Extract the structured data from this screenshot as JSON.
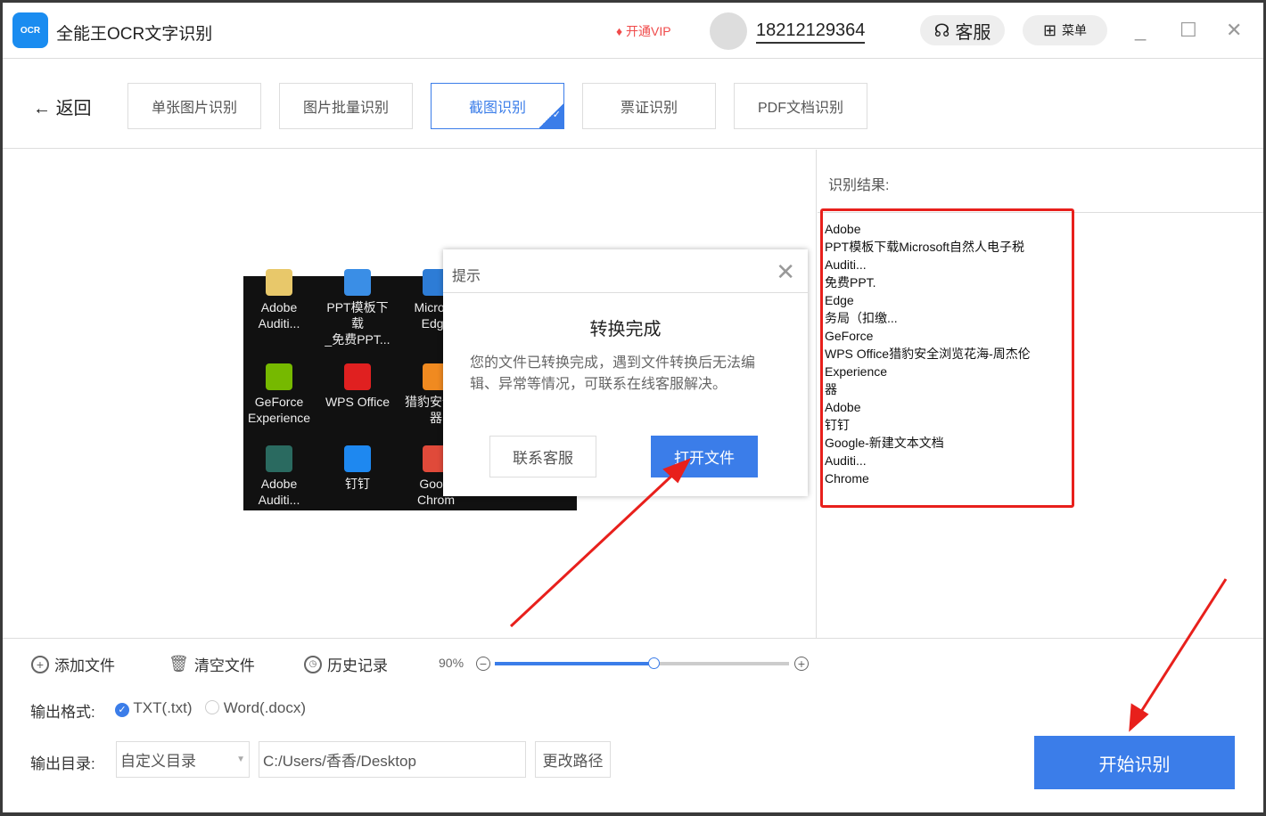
{
  "app": {
    "title": "全能王OCR文字识别",
    "logo_text": "OCR",
    "vip": "开通VIP",
    "phone": "18212129364",
    "service": "客服",
    "menu": "菜单"
  },
  "nav": {
    "back": "返回",
    "tabs": [
      {
        "label": "单张图片识别"
      },
      {
        "label": "图片批量识别"
      },
      {
        "label": "截图识别",
        "active": true
      },
      {
        "label": "票证识别"
      },
      {
        "label": "PDF文档识别"
      }
    ]
  },
  "preview": {
    "icons": [
      [
        "Adobe",
        "Auditi..."
      ],
      [
        "PPT模板下载",
        "_免费PPT..."
      ],
      [
        "Microso",
        "Edge"
      ],
      [
        "GeForce",
        "Experience"
      ],
      [
        "WPS Office",
        ""
      ],
      [
        "猎豹安全浏",
        "器"
      ],
      [
        "Adobe",
        "Auditi..."
      ],
      [
        "钉钉",
        ""
      ],
      [
        "Googl",
        "Chrom"
      ]
    ]
  },
  "dialog": {
    "title": "提示",
    "heading": "转换完成",
    "message": "您的文件已转换完成，遇到文件转换后无法编辑、异常等情况，可联系在线客服解决。",
    "contact": "联系客服",
    "open": "打开文件"
  },
  "result": {
    "label": "识别结果:",
    "lines": [
      "Adobe",
      "PPT模板下载Microsoft自然人电子税",
      "Auditi...",
      "免费PPT.",
      "Edge",
      "务局（扣缴...",
      "GeForce",
      "WPS Office猎豹安全浏览花海-周杰伦",
      "Experience",
      "器",
      "Adobe",
      "钉钉",
      "Google-新建文本文档",
      "Auditi...",
      "Chrome"
    ]
  },
  "toolbar": {
    "add": "添加文件",
    "clear": "清空文件",
    "history": "历史记录",
    "zoom": "90%",
    "zoom_fraction": 0.54
  },
  "output": {
    "format_label": "输出格式:",
    "txt": "TXT(.txt)",
    "word": "Word(.docx)",
    "selected": "TXT(.txt)",
    "dir_label": "输出目录:",
    "dir_select": "自定义目录",
    "path": "C:/Users/香香/Desktop",
    "change": "更改路径"
  },
  "start": "开始识别",
  "colors": {
    "accent": "#3b7de9",
    "highlight": "#e8201c"
  }
}
